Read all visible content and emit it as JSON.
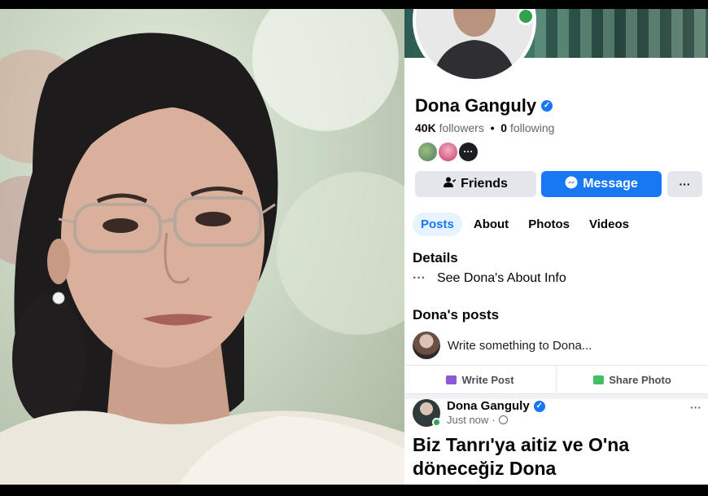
{
  "profile": {
    "name": "Dona Ganguly",
    "verified_icon": "verified-badge-icon",
    "followers_count": "40K",
    "followers_label": "followers",
    "separator": "•",
    "following_count": "0",
    "following_label": "following",
    "more_friends_glyph": "···",
    "online_color": "#31a24c"
  },
  "buttons": {
    "friends": "Friends",
    "message": "Message",
    "more": "···"
  },
  "tabs": [
    {
      "label": "Posts",
      "active": true
    },
    {
      "label": "About",
      "active": false
    },
    {
      "label": "Photos",
      "active": false
    },
    {
      "label": "Videos",
      "active": false
    }
  ],
  "details": {
    "title": "Details",
    "dots": "···",
    "about_link": "See Dona's About Info"
  },
  "posts_section": {
    "title": "Dona's posts",
    "composer_placeholder": "Write something to Dona...",
    "write_post": "Write Post",
    "share_photo": "Share Photo"
  },
  "post": {
    "author": "Dona Ganguly",
    "time": "Just now",
    "time_separator": "·",
    "more": "···",
    "text_line1": "Biz Tanrı'ya aitiz ve O'na",
    "text_line2": "döneceğiz Dona"
  },
  "colors": {
    "accent": "#1877f2",
    "button_gray": "#e4e6eb",
    "tab_active_bg": "#e7f3ff"
  }
}
